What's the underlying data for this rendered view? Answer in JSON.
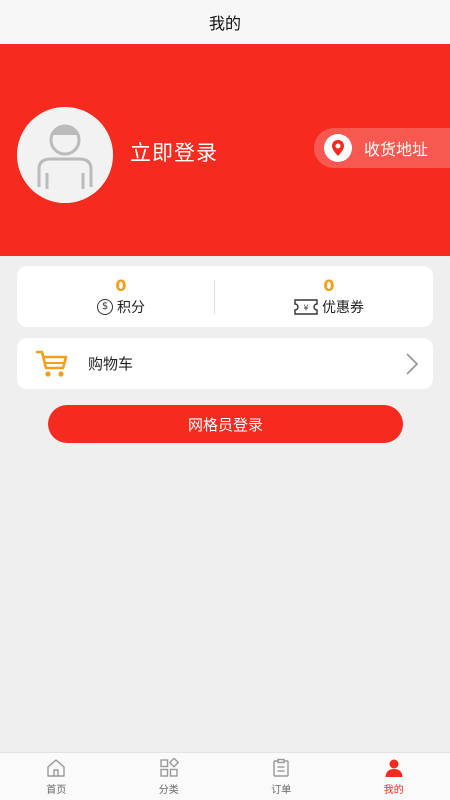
{
  "header": {
    "title": "我的"
  },
  "profile": {
    "login_text": "立即登录",
    "address_label": "收货地址"
  },
  "stats": {
    "points": {
      "value": "0",
      "label": "积分",
      "icon": "dollar-coin-icon"
    },
    "coupons": {
      "value": "0",
      "label": "优惠券",
      "icon": "yen-ticket-icon"
    }
  },
  "cart": {
    "label": "购物车",
    "icon": "shopping-cart-icon"
  },
  "grid_login": {
    "label": "网格员登录"
  },
  "tabbar": {
    "items": [
      {
        "label": "首页",
        "icon": "home-icon",
        "active": false
      },
      {
        "label": "分类",
        "icon": "category-icon",
        "active": false
      },
      {
        "label": "订单",
        "icon": "order-icon",
        "active": false
      },
      {
        "label": "我的",
        "icon": "user-icon",
        "active": true
      }
    ]
  },
  "colors": {
    "brand_red": "#f52b1f",
    "accent_orange": "#f0a01c",
    "background": "#efeff0"
  }
}
